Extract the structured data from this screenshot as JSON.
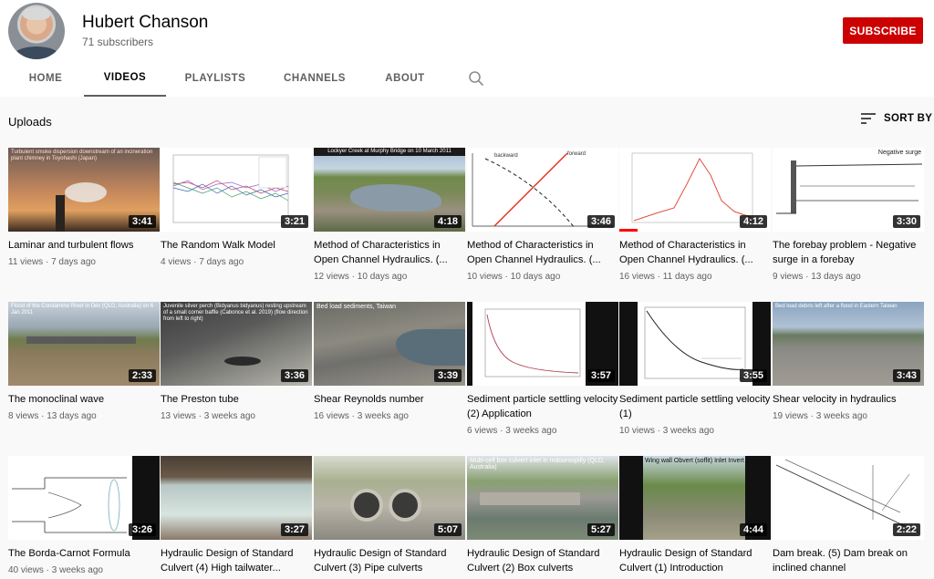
{
  "channel": {
    "name": "Hubert Chanson",
    "subscribers": "71 subscribers",
    "subscribe_label": "SUBSCRIBE"
  },
  "tabs": [
    {
      "label": "HOME",
      "active": false
    },
    {
      "label": "VIDEOS",
      "active": true
    },
    {
      "label": "PLAYLISTS",
      "active": false
    },
    {
      "label": "CHANNELS",
      "active": false
    },
    {
      "label": "ABOUT",
      "active": false
    }
  ],
  "icons": {
    "tab_search": "search-icon",
    "sort": "sort-lines-icon"
  },
  "section": {
    "title": "Uploads",
    "sort_label": "SORT BY"
  },
  "colors": {
    "subscribe": "#cc0000",
    "progress": "#ff0000",
    "meta": "#606060"
  },
  "videos": [
    {
      "title": "Laminar and turbulent flows",
      "views": "11 views",
      "age": "7 days ago",
      "duration": "3:41",
      "thumb_caption": "Turbulent smoke dispersion downstream of an incineration plant chimney in Toyohashi (Japan)"
    },
    {
      "title": "The Random Walk Model",
      "views": "4 views",
      "age": "7 days ago",
      "duration": "3:21",
      "thumb_caption": ""
    },
    {
      "title": "Method of Characteristics in Open Channel Hydraulics. (...",
      "views": "12 views",
      "age": "10 days ago",
      "duration": "4:18",
      "thumb_caption": "Lockyer Creek at Murphy Bridge on 10 March 2011"
    },
    {
      "title": "Method of Characteristics in Open Channel Hydraulics. (...",
      "views": "10 views",
      "age": "10 days ago",
      "duration": "3:46",
      "thumb_caption": ""
    },
    {
      "title": "Method of Characteristics in Open Channel Hydraulics. (...",
      "views": "16 views",
      "age": "11 days ago",
      "duration": "4:12",
      "thumb_caption": "",
      "progress": 0.12
    },
    {
      "title": "The forebay problem - Negative surge in a forebay",
      "views": "9 views",
      "age": "13 days ago",
      "duration": "3:30",
      "thumb_caption": "Negative surge"
    },
    {
      "title": "The monoclinal wave",
      "views": "8 views",
      "age": "13 days ago",
      "duration": "2:33",
      "thumb_caption": "Flood of the Condamine River in Dec (QLD, Australia) on 6 Jan 2011"
    },
    {
      "title": "The Preston tube",
      "views": "13 views",
      "age": "3 weeks ago",
      "duration": "3:36",
      "thumb_caption": "Juvenile silver perch (Bidyanus bidyanus) resting upstream of a small corner baffle (Cabonce et al. 2019) (flow direction from left to right)"
    },
    {
      "title": "Shear Reynolds number",
      "views": "16 views",
      "age": "3 weeks ago",
      "duration": "3:39",
      "thumb_caption": "Bed load sediments, Taiwan"
    },
    {
      "title": "Sediment particle settling velocity (2) Application",
      "views": "6 views",
      "age": "3 weeks ago",
      "duration": "3:57",
      "thumb_caption": ""
    },
    {
      "title": "Sediment particle settling velocity (1)",
      "views": "10 views",
      "age": "3 weeks ago",
      "duration": "3:55",
      "thumb_caption": ""
    },
    {
      "title": "Shear velocity in hydraulics",
      "views": "19 views",
      "age": "3 weeks ago",
      "duration": "3:43",
      "thumb_caption": "Bed load debris left after a flood in Eastern Taiwan"
    },
    {
      "title": "The Borda-Carnot Formula",
      "views": "40 views",
      "age": "3 weeks ago",
      "duration": "3:26",
      "thumb_caption": ""
    },
    {
      "title": "Hydraulic Design of Standard Culvert (4) High tailwater...",
      "views": "",
      "age": "",
      "duration": "3:27",
      "thumb_caption": ""
    },
    {
      "title": "Hydraulic Design of Standard Culvert (3) Pipe culverts",
      "views": "",
      "age": "",
      "duration": "5:07",
      "thumb_caption": ""
    },
    {
      "title": "Hydraulic Design of Standard Culvert (2) Box culverts",
      "views": "",
      "age": "",
      "duration": "5:27",
      "thumb_caption": "Multi-cell box culvert inlet in Indooroopilly (QLD, Australia)"
    },
    {
      "title": "Hydraulic Design of Standard Culvert (1) Introduction",
      "views": "",
      "age": "",
      "duration": "4:44",
      "thumb_caption": "Wing wall   Obvert (soffit)   Inlet   Invert   Barrel"
    },
    {
      "title": "Dam break. (5) Dam break on inclined channel",
      "views": "",
      "age": "",
      "duration": "2:22",
      "thumb_caption": ""
    }
  ]
}
